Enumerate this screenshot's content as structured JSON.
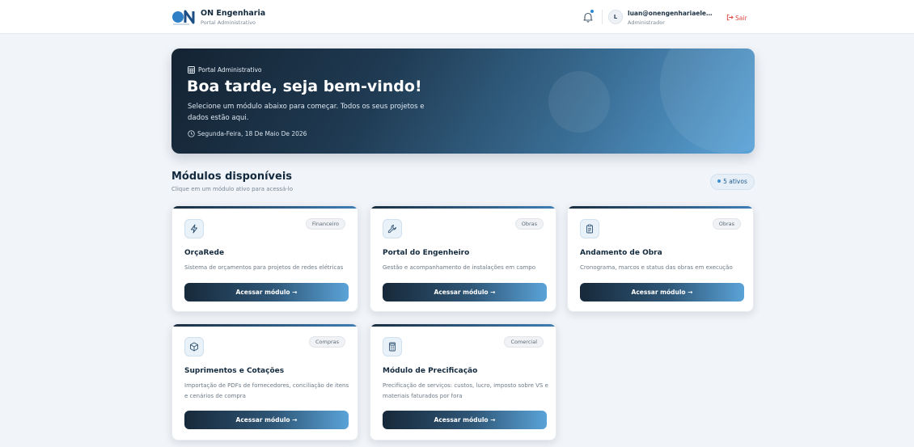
{
  "header": {
    "brand_title": "ON Engenharia",
    "brand_subtitle": "Portal Administrativo",
    "user_initial": "L",
    "user_email": "luan@onengenhariaeletric...",
    "user_role": "Administrador",
    "logout_label": "Sair",
    "icons": [
      "bell-icon",
      "logout-icon"
    ]
  },
  "hero": {
    "kicker": "Portal Administrativo",
    "title": "Boa tarde, seja bem-vindo!",
    "description": "Selecione um módulo abaixo para começar. Todos os seus projetos e dados estão aqui.",
    "date": "Segunda-Feira, 18 De Maio De 2026"
  },
  "modules": {
    "title": "Módulos disponíveis",
    "subtitle": "Clique em um módulo ativo para acessá-lo",
    "active_badge": "5 ativos",
    "items": [
      {
        "icon": "zap-icon",
        "tag": "Financeiro",
        "title": "OrçaRede",
        "description": "Sistema de orçamentos para projetos de redes elétricas",
        "button": "Acessar módulo →"
      },
      {
        "icon": "wrench-icon",
        "tag": "Obras",
        "title": "Portal do Engenheiro",
        "description": "Gestão e acompanhamento de instalações em campo",
        "button": "Acessar módulo →"
      },
      {
        "icon": "clipboard-icon",
        "tag": "Obras",
        "title": "Andamento de Obra",
        "description": "Cronograma, marcos e status das obras em execução",
        "button": "Acessar módulo →"
      },
      {
        "icon": "box-icon",
        "tag": "Compras",
        "title": "Suprimentos e Cotações",
        "description": "Importação de PDFs de fornecedores, conciliação de itens e cenários de compra",
        "button": "Acessar módulo →"
      },
      {
        "icon": "calculator-icon",
        "tag": "Comercial",
        "title": "Módulo de Precificação",
        "description": "Precificação de serviços: custos, lucro, imposto sobre VS e materiais faturados por fora",
        "button": "Acessar módulo →"
      }
    ]
  },
  "colors": {
    "accent": "#3d8fd1",
    "hero_dark": "#142332",
    "hero_light": "#5aa3d8",
    "logout": "#e0453e"
  }
}
